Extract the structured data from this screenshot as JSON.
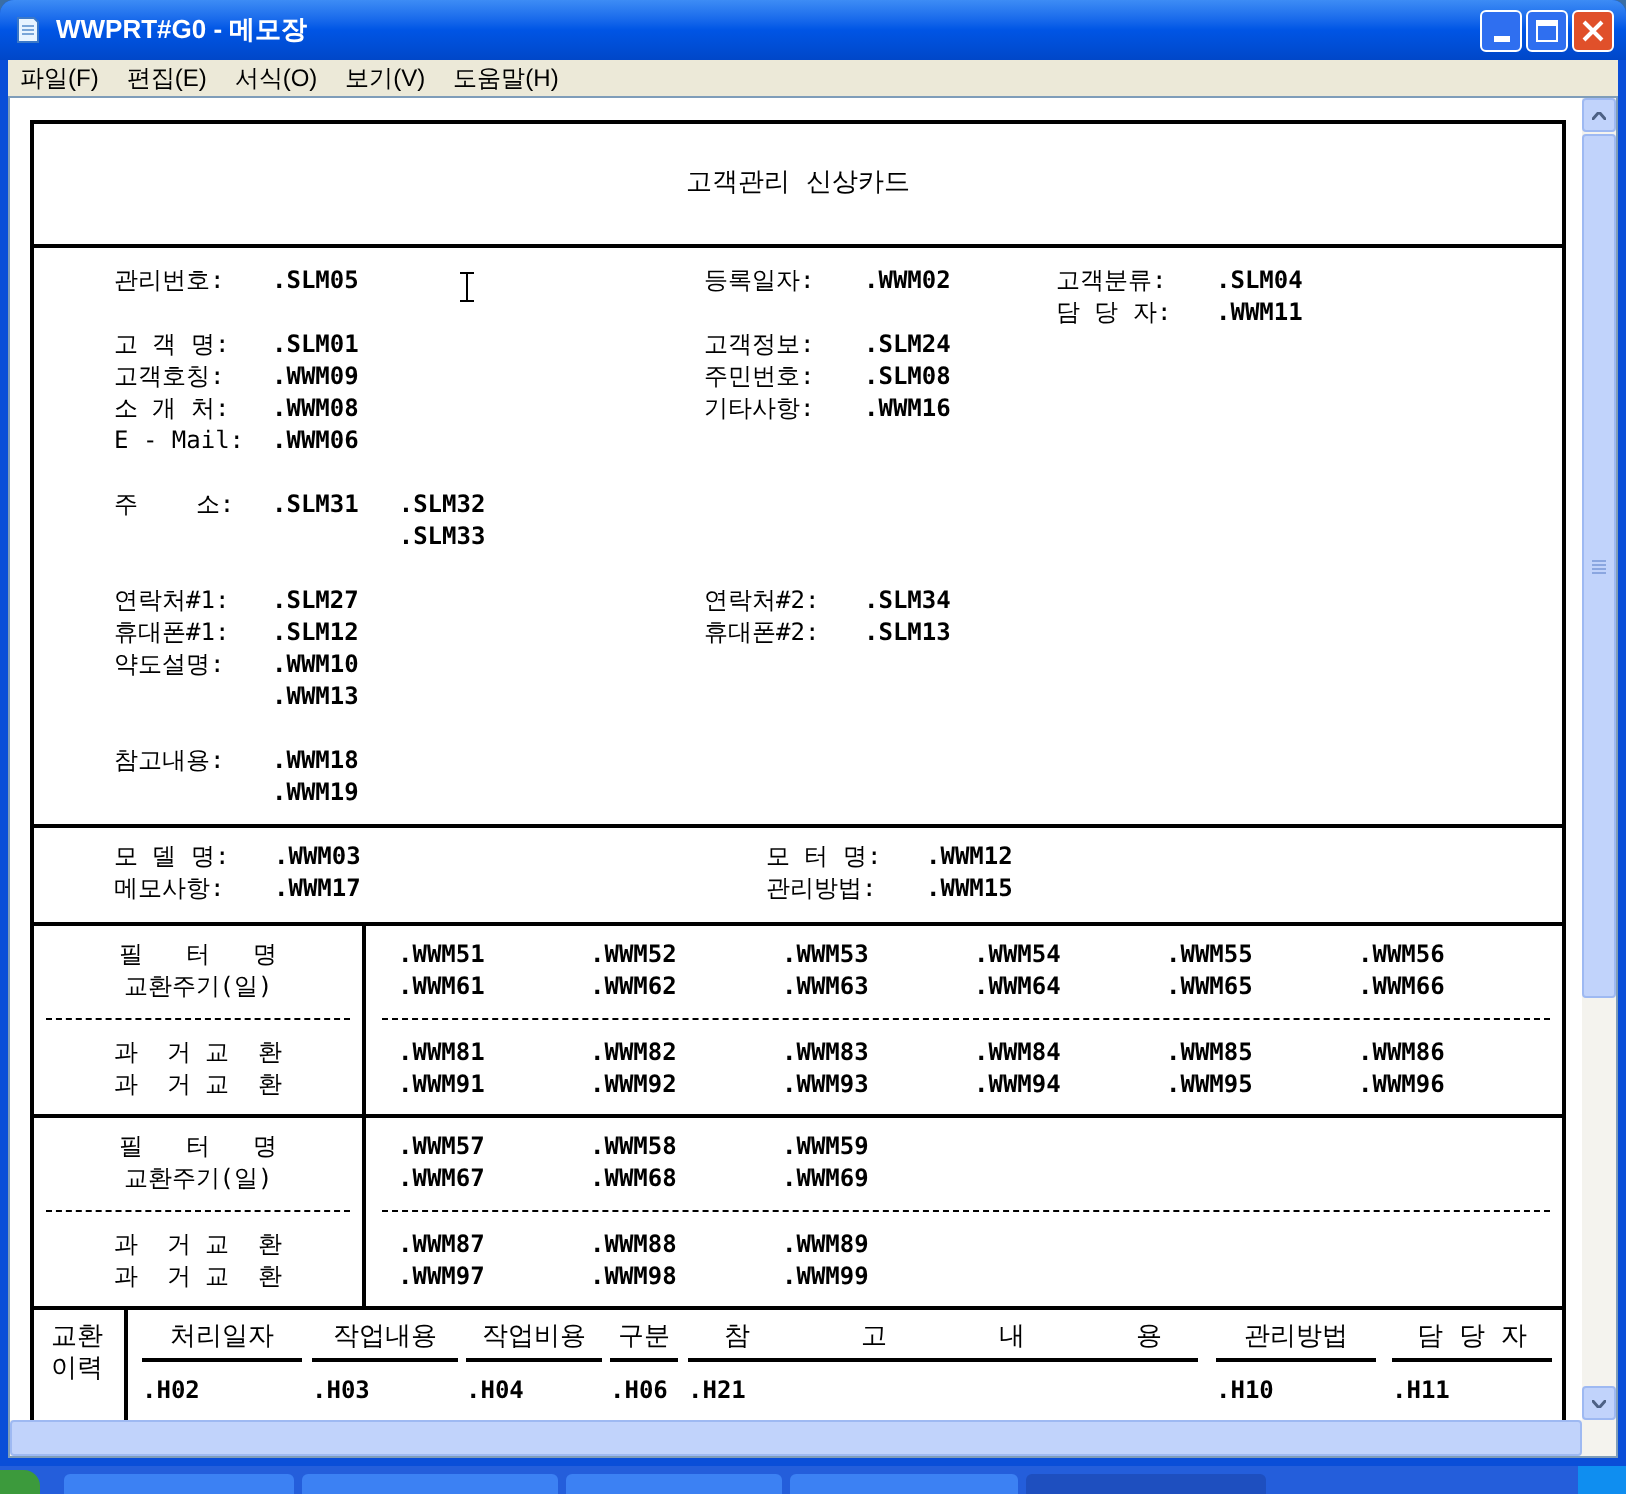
{
  "window": {
    "title": "WWPRT#G0 - 메모장"
  },
  "menu": [
    "파일(F)",
    "편집(E)",
    "서식(O)",
    "보기(V)",
    "도움말(H)"
  ],
  "document": {
    "title": "고객관리 신상카드",
    "info_blocks": [
      [
        {
          "left": {
            "label": "관리번호:",
            "values": [
              ".SLM05"
            ]
          },
          "middle": {
            "label": "등록일자:",
            "values": [
              ".WWM02"
            ]
          },
          "right": {
            "label": "고객분류:",
            "values": [
              ".SLM04"
            ]
          }
        },
        {
          "right": {
            "label": "담 당 자:",
            "values": [
              ".WWM11"
            ]
          }
        },
        {
          "left": {
            "label": "고 객 명:",
            "values": [
              ".SLM01"
            ]
          },
          "middle": {
            "label": "고객정보:",
            "values": [
              ".SLM24"
            ]
          }
        },
        {
          "left": {
            "label": "고객호칭:",
            "values": [
              ".WWM09"
            ]
          },
          "middle": {
            "label": "주민번호:",
            "values": [
              ".SLM08"
            ]
          }
        },
        {
          "left": {
            "label": "소 개 처:",
            "values": [
              ".WWM08"
            ]
          },
          "middle": {
            "label": "기타사항:",
            "values": [
              ".WWM16"
            ]
          }
        },
        {
          "left": {
            "label": "E - Mail:",
            "values": [
              ".WWM06"
            ]
          }
        }
      ],
      [
        {
          "left": {
            "label": "주    소:",
            "values": [
              ".SLM31"
            ],
            "extra": [
              ".SLM32",
              ".SLM33"
            ]
          }
        }
      ],
      [
        {
          "left": {
            "label": "연락처#1:",
            "values": [
              ".SLM27"
            ]
          },
          "middle": {
            "label": "연락처#2:",
            "values": [
              ".SLM34"
            ]
          }
        },
        {
          "left": {
            "label": "휴대폰#1:",
            "values": [
              ".SLM12"
            ]
          },
          "middle": {
            "label": "휴대폰#2:",
            "values": [
              ".SLM13"
            ]
          }
        },
        {
          "left": {
            "label": "약도설명:",
            "values": [
              ".WWM10",
              ".WWM13"
            ]
          }
        }
      ],
      [
        {
          "left": {
            "label": "참고내용:",
            "values": [
              ".WWM18",
              ".WWM19"
            ]
          }
        }
      ]
    ],
    "product_rows": [
      {
        "left": {
          "label": "모 델 명:",
          "values": [
            ".WWM03"
          ]
        },
        "right": {
          "label": "모 터 명:",
          "values": [
            ".WWM12"
          ]
        }
      },
      {
        "left": {
          "label": "메모사항:",
          "values": [
            ".WWM17"
          ]
        },
        "right": {
          "label": "관리방법:",
          "values": [
            ".WWM15"
          ]
        }
      }
    ],
    "filter_tables": [
      {
        "top_labels": [
          "필   터   명",
          "교환주기(일)"
        ],
        "top_rows": [
          [
            ".WWM51",
            ".WWM52",
            ".WWM53",
            ".WWM54",
            ".WWM55",
            ".WWM56"
          ],
          [
            ".WWM61",
            ".WWM62",
            ".WWM63",
            ".WWM64",
            ".WWM65",
            ".WWM66"
          ]
        ],
        "bottom_labels": [
          "과  거 교  환",
          "과  거 교  환"
        ],
        "bottom_rows": [
          [
            ".WWM81",
            ".WWM82",
            ".WWM83",
            ".WWM84",
            ".WWM85",
            ".WWM86"
          ],
          [
            ".WWM91",
            ".WWM92",
            ".WWM93",
            ".WWM94",
            ".WWM95",
            ".WWM96"
          ]
        ]
      },
      {
        "top_labels": [
          "필   터   명",
          "교환주기(일)"
        ],
        "top_rows": [
          [
            ".WWM57",
            ".WWM58",
            ".WWM59"
          ],
          [
            ".WWM67",
            ".WWM68",
            ".WWM69"
          ]
        ],
        "bottom_labels": [
          "과  거 교  환",
          "과  거 교  환"
        ],
        "bottom_rows": [
          [
            ".WWM87",
            ".WWM88",
            ".WWM89"
          ],
          [
            ".WWM97",
            ".WWM98",
            ".WWM99"
          ]
        ]
      }
    ],
    "history": {
      "label": "교환이력",
      "columns": [
        {
          "header": "처리일자",
          "value": ".H02"
        },
        {
          "header": "작업내용",
          "value": ".H03"
        },
        {
          "header": "작업비용",
          "value": ".H04"
        },
        {
          "header": "구분",
          "value": ".H06"
        },
        {
          "header": "참 고 내 용",
          "value": ".H21"
        },
        {
          "header": "관리방법",
          "value": ".H10"
        },
        {
          "header": "담 당 자",
          "value": ".H11"
        }
      ]
    }
  }
}
